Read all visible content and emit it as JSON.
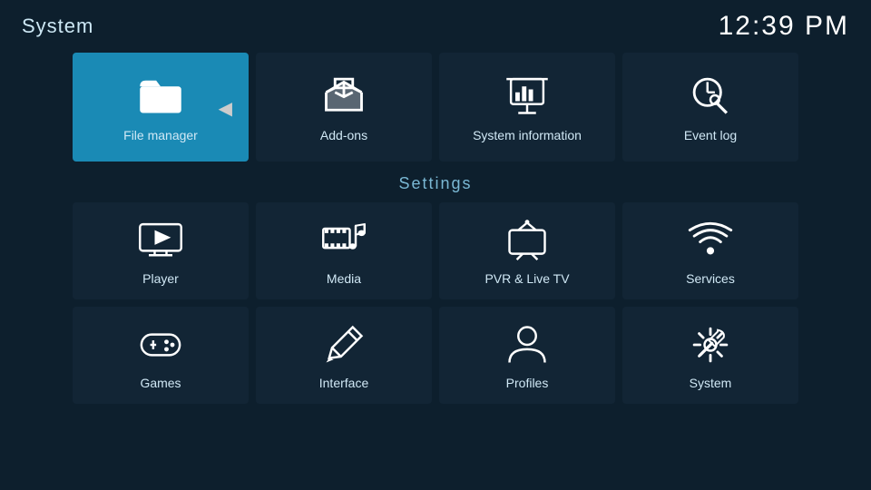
{
  "topBar": {
    "appTitle": "System",
    "clock": "12:39 PM"
  },
  "topItems": [
    {
      "id": "file-manager",
      "label": "File manager",
      "selected": true
    },
    {
      "id": "add-ons",
      "label": "Add-ons",
      "selected": false
    },
    {
      "id": "system-information",
      "label": "System information",
      "selected": false
    },
    {
      "id": "event-log",
      "label": "Event log",
      "selected": false
    }
  ],
  "settingsLabel": "Settings",
  "settingsRow1": [
    {
      "id": "player",
      "label": "Player"
    },
    {
      "id": "media",
      "label": "Media"
    },
    {
      "id": "pvr-live-tv",
      "label": "PVR & Live TV"
    },
    {
      "id": "services",
      "label": "Services"
    }
  ],
  "settingsRow2": [
    {
      "id": "games",
      "label": "Games"
    },
    {
      "id": "interface",
      "label": "Interface"
    },
    {
      "id": "profiles",
      "label": "Profiles"
    },
    {
      "id": "system",
      "label": "System"
    }
  ]
}
